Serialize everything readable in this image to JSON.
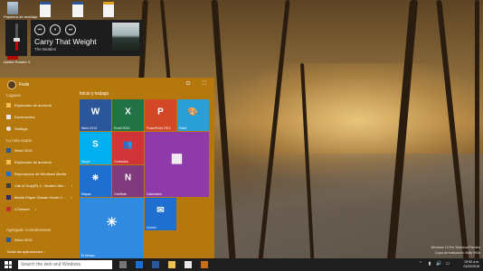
{
  "desktop": {
    "icons": [
      {
        "label": "Papelera de reciclaje",
        "icon": "recycle-bin-icon"
      },
      {
        "label": "",
        "icon": "document-icon"
      },
      {
        "label": "",
        "icon": "document-icon"
      },
      {
        "label": "",
        "icon": "document-icon"
      },
      {
        "label": "Adobe Reader X",
        "icon": "adobe-reader-icon"
      }
    ]
  },
  "media": {
    "song": "Carry That Weight",
    "artist": "The Beatles",
    "prev_icon": "⏮",
    "pause_icon": "⏸",
    "next_icon": "⏭"
  },
  "start": {
    "user": "Fede",
    "power_icon": "⏻",
    "expand_icon": "⛶",
    "sections": {
      "places": "Lugares",
      "most_used": "Lo más usado",
      "recently_added": "Agregado recientemente"
    },
    "places": [
      {
        "label": "Explorador de archivos",
        "color": "#f0c050"
      },
      {
        "label": "Documentos",
        "color": "#e8e8e8"
      },
      {
        "label": "Settings",
        "color": "#e8e8e8"
      }
    ],
    "most_used": [
      {
        "label": "Word 2013",
        "color": "#2b579a",
        "arrow": ""
      },
      {
        "label": "Explorador de archivos",
        "color": "#f0c050",
        "arrow": ""
      },
      {
        "label": "Reproductor de Windows Media",
        "color": "#1a6ed8",
        "arrow": ""
      },
      {
        "label": "Call of Duty(R) 4 - Modern Wa...",
        "color": "#3a3a3a",
        "arrow": "›"
      },
      {
        "label": "Media Player Classic Home C...",
        "color": "#2a2a6a",
        "arrow": "›"
      },
      {
        "label": "CCleaner",
        "color": "#c03030",
        "arrow": "›"
      }
    ],
    "recent": [
      {
        "label": "Word 2013",
        "color": "#2b579a"
      }
    ],
    "all_apps": "Todas las aplicaciones ↓",
    "group_title": "Inicio y trabajo",
    "tiles": [
      {
        "label": "Word 2013",
        "glyph": "W",
        "color": "#2b579a"
      },
      {
        "label": "Excel 2013",
        "glyph": "X",
        "color": "#217346"
      },
      {
        "label": "PowerPoint 2013",
        "glyph": "P",
        "color": "#d24726"
      },
      {
        "label": "Paint",
        "glyph": "🎨",
        "color": "#2a9fd6"
      },
      {
        "label": "Skype",
        "glyph": "S",
        "color": "#00aff0"
      },
      {
        "label": "Contactos",
        "glyph": "👥",
        "color": "#d03438"
      },
      {
        "label": "Calendario",
        "glyph": "▦",
        "color": "#8e3aa8"
      },
      {
        "label": "Mapas",
        "glyph": "⛯",
        "color": "#1e6fd0"
      },
      {
        "label": "OneNote",
        "glyph": "N",
        "color": "#80397b"
      },
      {
        "label": "El tiempo",
        "glyph": "☀",
        "color": "#2f8ae0"
      },
      {
        "label": "Correo",
        "glyph": "✉",
        "color": "#1e6fd0"
      }
    ]
  },
  "watermark": {
    "line1": "Windows 10 Pro Technical Preview",
    "line2": "Copia de evaluación. Build 9926"
  },
  "taskbar": {
    "search_placeholder": "Search the web and Windows",
    "time": "02:52 a.m.",
    "date": "01/02/2015"
  }
}
